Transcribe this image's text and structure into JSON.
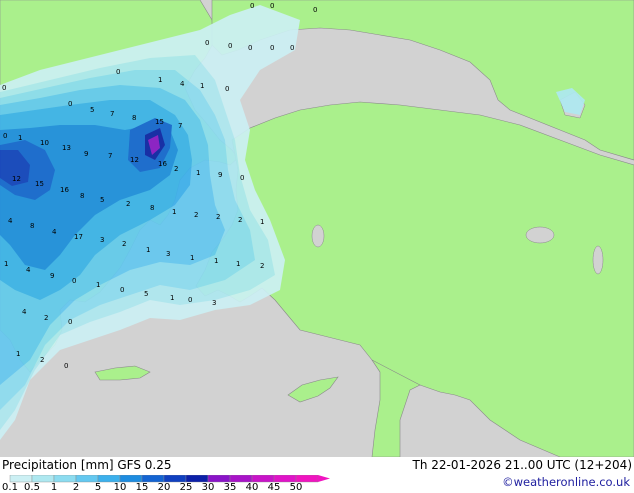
{
  "footer": {
    "title": "Precipitation [mm]  GFS 0.25",
    "run_info": "Th 22-01-2026 21..00 UTC (12+204)",
    "credit": "©weatheronline.co.uk"
  },
  "legend": {
    "ticks": [
      "0.1",
      "0.5",
      "1",
      "2",
      "5",
      "10",
      "15",
      "20",
      "25",
      "30",
      "35",
      "40",
      "45",
      "50"
    ],
    "colors": [
      "#ccf0f4",
      "#aee8f0",
      "#8cdcf0",
      "#64c8f0",
      "#3cb0ec",
      "#1e8ce0",
      "#1464d2",
      "#1040c0",
      "#0c20a8",
      "#8a14c8",
      "#a814c8",
      "#c814c8",
      "#e014c8",
      "#f014c0"
    ]
  },
  "map": {
    "colors": {
      "land": "#aaf08c",
      "sea": "#d2d2d2",
      "border": "#9a9a9a"
    },
    "values": [
      "0",
      "0",
      "0",
      "0",
      "0",
      "0",
      "0",
      "0",
      "0",
      "0",
      "0",
      "1",
      "4",
      "1",
      "0",
      "5",
      "7",
      "8",
      "15",
      "7",
      "1",
      "10",
      "13",
      "9",
      "7",
      "0",
      "12",
      "16",
      "12",
      "2",
      "1",
      "9",
      "0",
      "15",
      "16",
      "8",
      "5",
      "2",
      "8",
      "1",
      "2",
      "2",
      "2",
      "1",
      "4",
      "8",
      "4",
      "17",
      "3",
      "2",
      "1",
      "3",
      "1",
      "1",
      "1",
      "2",
      "1",
      "4",
      "9",
      "0",
      "1",
      "0",
      "5",
      "1",
      "0",
      "3",
      "4",
      "2",
      "0",
      "1",
      "2",
      "0"
    ]
  }
}
